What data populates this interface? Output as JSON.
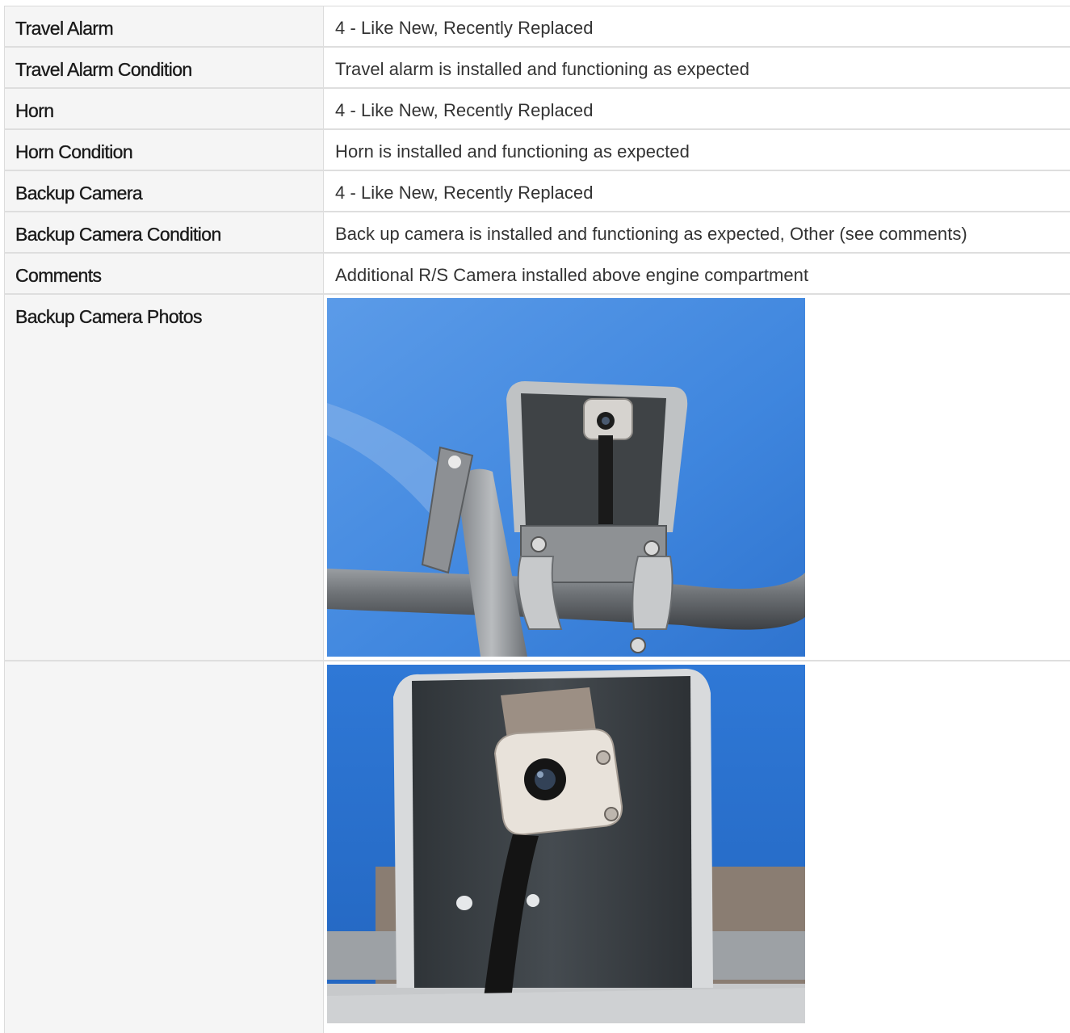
{
  "rows": [
    {
      "label": "Travel Alarm",
      "value": "4 - Like New, Recently Replaced"
    },
    {
      "label": "Travel Alarm Condition",
      "value": "Travel alarm is installed and functioning as expected"
    },
    {
      "label": "Horn",
      "value": "4 - Like New, Recently Replaced"
    },
    {
      "label": "Horn Condition",
      "value": "Horn is installed and functioning as expected"
    },
    {
      "label": "Backup Camera",
      "value": "4 - Like New, Recently Replaced"
    },
    {
      "label": "Backup Camera Condition",
      "value": "Back up camera is installed and functioning as expected, Other (see comments)"
    },
    {
      "label": "Comments",
      "value": "Additional R/S Camera installed above engine compartment"
    }
  ],
  "photos": {
    "label": "Backup Camera Photos",
    "items": [
      {
        "subject": "camera-mount-wide-photo"
      },
      {
        "subject": "camera-closeup-photo"
      }
    ]
  },
  "colors": {
    "sky": "#3f86de",
    "label_bg": "#f5f5f5",
    "border": "#dedede"
  }
}
